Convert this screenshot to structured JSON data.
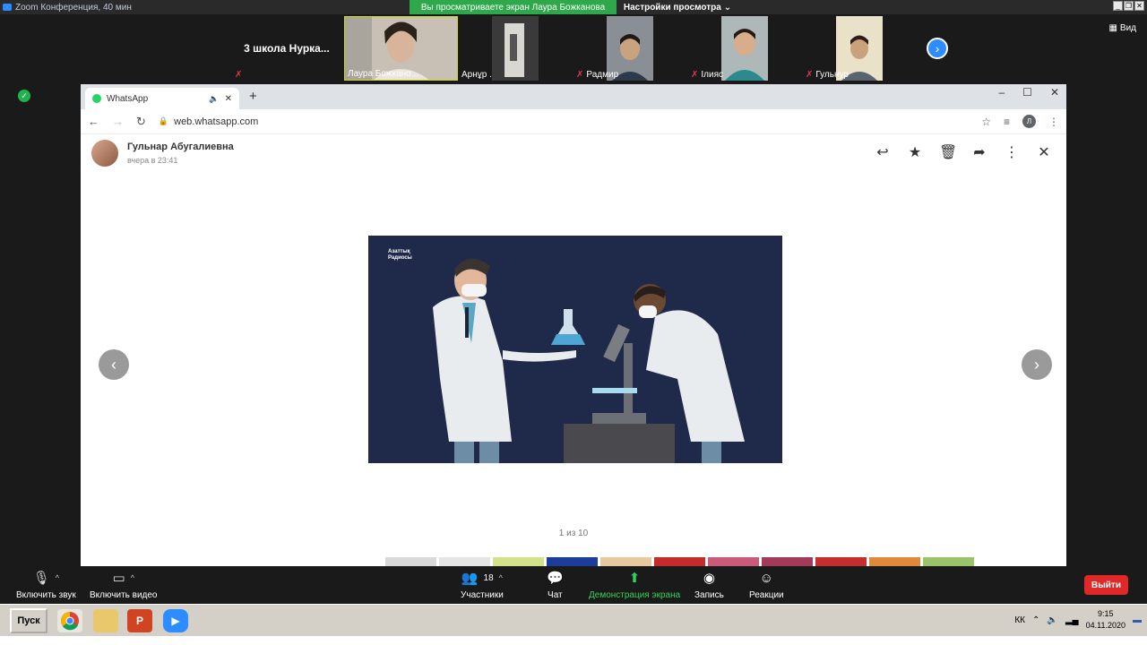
{
  "zoom": {
    "window_title": "Zoom Конференция, 40 мин",
    "share_banner": "Вы просматриваете экран Лаура Божканова",
    "view_settings": "Настройки просмотра",
    "view_button": "Вид",
    "participants_strip": [
      {
        "name": "3 школа Нурка..."
      },
      {
        "name": "Лаура Божкано..."
      },
      {
        "name": "Арнұр ."
      },
      {
        "name": "Радмир"
      },
      {
        "name": "Ілияс"
      },
      {
        "name": "Гульнур"
      }
    ]
  },
  "browser": {
    "tab_title": "WhatsApp",
    "url": "web.whatsapp.com",
    "profile_initial": "Л"
  },
  "viewer": {
    "sender_name": "Гульнар Абугалиевна",
    "sender_time": "вчера в 23:41",
    "counter": "1 из 10",
    "image_logo_line1": "Азаттық",
    "image_logo_line2": "Радиосы"
  },
  "toolbar": {
    "unmute": "Включить звук",
    "start_video": "Включить видео",
    "participants": "Участники",
    "participants_count": "18",
    "chat": "Чат",
    "share_screen": "Демонстрация экрана",
    "record": "Запись",
    "reactions": "Реакции",
    "leave": "Выйти"
  },
  "taskbar": {
    "start": "Пуск",
    "language": "КК",
    "time": "9:15",
    "date": "04.11.2020"
  }
}
